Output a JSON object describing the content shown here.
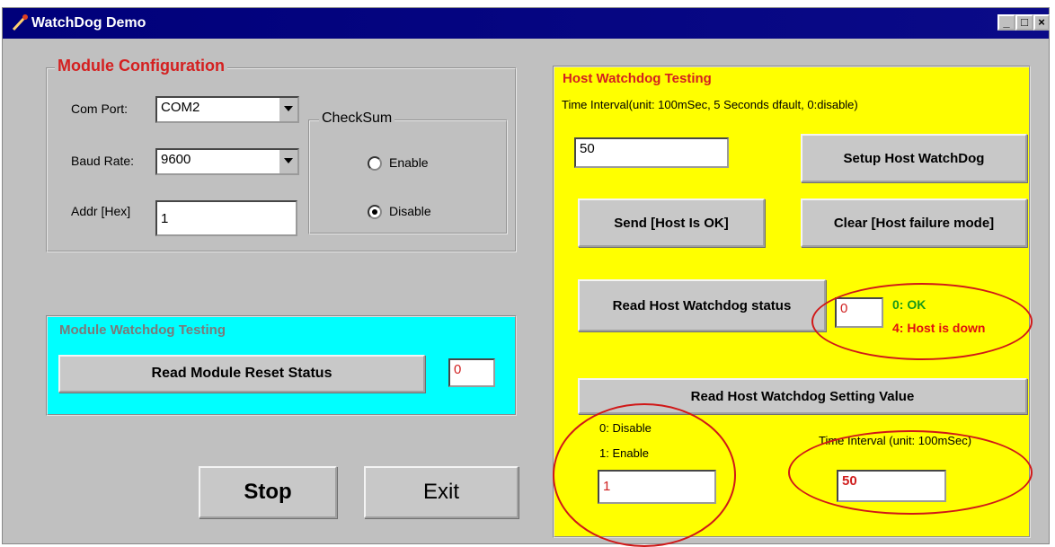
{
  "window": {
    "title": "WatchDog Demo",
    "controls": [
      "_",
      "□",
      "×"
    ]
  },
  "module_config": {
    "legend": "Module Configuration",
    "com_port_label": "Com Port:",
    "com_port_value": "COM2",
    "baud_rate_label": "Baud Rate:",
    "baud_rate_value": "9600",
    "addr_label": "Addr [Hex]",
    "addr_value": "1",
    "checksum": {
      "legend": "CheckSum",
      "enable_label": "Enable",
      "disable_label": "Disable",
      "selected": "Disable"
    }
  },
  "module_watchdog": {
    "legend": "Module Watchdog Testing",
    "read_reset_label": "Read Module Reset Status",
    "reset_status_value": "0"
  },
  "footer": {
    "stop_label": "Stop",
    "exit_label": "Exit"
  },
  "host_watchdog": {
    "legend": "Host Watchdog Testing",
    "interval_hint": "Time Interval(unit: 100mSec, 5 Seconds dfault, 0:disable)",
    "interval_value": "50",
    "setup_label": "Setup Host WatchDog",
    "send_ok_label": "Send [Host Is OK]",
    "clear_failure_label": "Clear [Host failure mode]",
    "read_status_label": "Read Host Watchdog status",
    "status_value": "0",
    "status_ok_text": "0: OK",
    "status_down_text": "4: Host is down",
    "read_setting_label": "Read Host Watchdog Setting Value",
    "disable_text": "0: Disable",
    "enable_text": "1: Enable",
    "enable_value": "1",
    "setting_interval_label": "Time Interval (unit: 100mSec)",
    "setting_interval_value": "50"
  },
  "colors": {
    "title_bar": "#00007a",
    "host_panel": "#ffff00",
    "module_watchdog_panel": "#00ffff",
    "legend_red": "#d42020",
    "ok_green": "#1a9a1a",
    "down_red": "#e01010",
    "annotation_red": "#d01818"
  }
}
